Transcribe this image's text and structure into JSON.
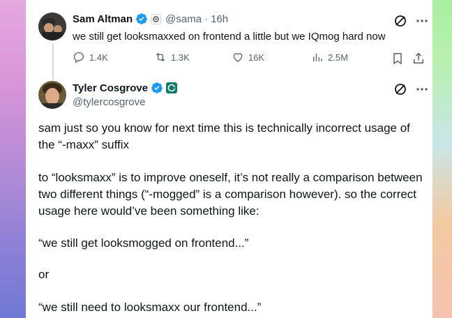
{
  "tweet1": {
    "author_name": "Sam Altman",
    "handle": "@sama",
    "separator": "·",
    "time": "16h",
    "text": "we still get looksmaxxed on frontend a little but we IQmog hard now",
    "replies": "1.4K",
    "retweets": "1.3K",
    "likes": "16K",
    "views": "2.5M"
  },
  "tweet2": {
    "author_name": "Tyler Cosgrove",
    "handle": "@tylercosgrove",
    "paragraphs": [
      "sam just so you know for next time this is technically incorrect usage of the “-maxx” suffix",
      "to “looksmaxx” is to improve oneself, it’s not really a comparison between two different things (“-mogged” is a comparison however). so the correct usage here would’ve been something like:",
      "“we still get looksmogged on frontend...”",
      "or",
      "“we still need to looksmaxx our frontend...”"
    ]
  },
  "colors": {
    "verified": "#1d9bf0",
    "text": "#0f1419",
    "muted": "#536471"
  }
}
